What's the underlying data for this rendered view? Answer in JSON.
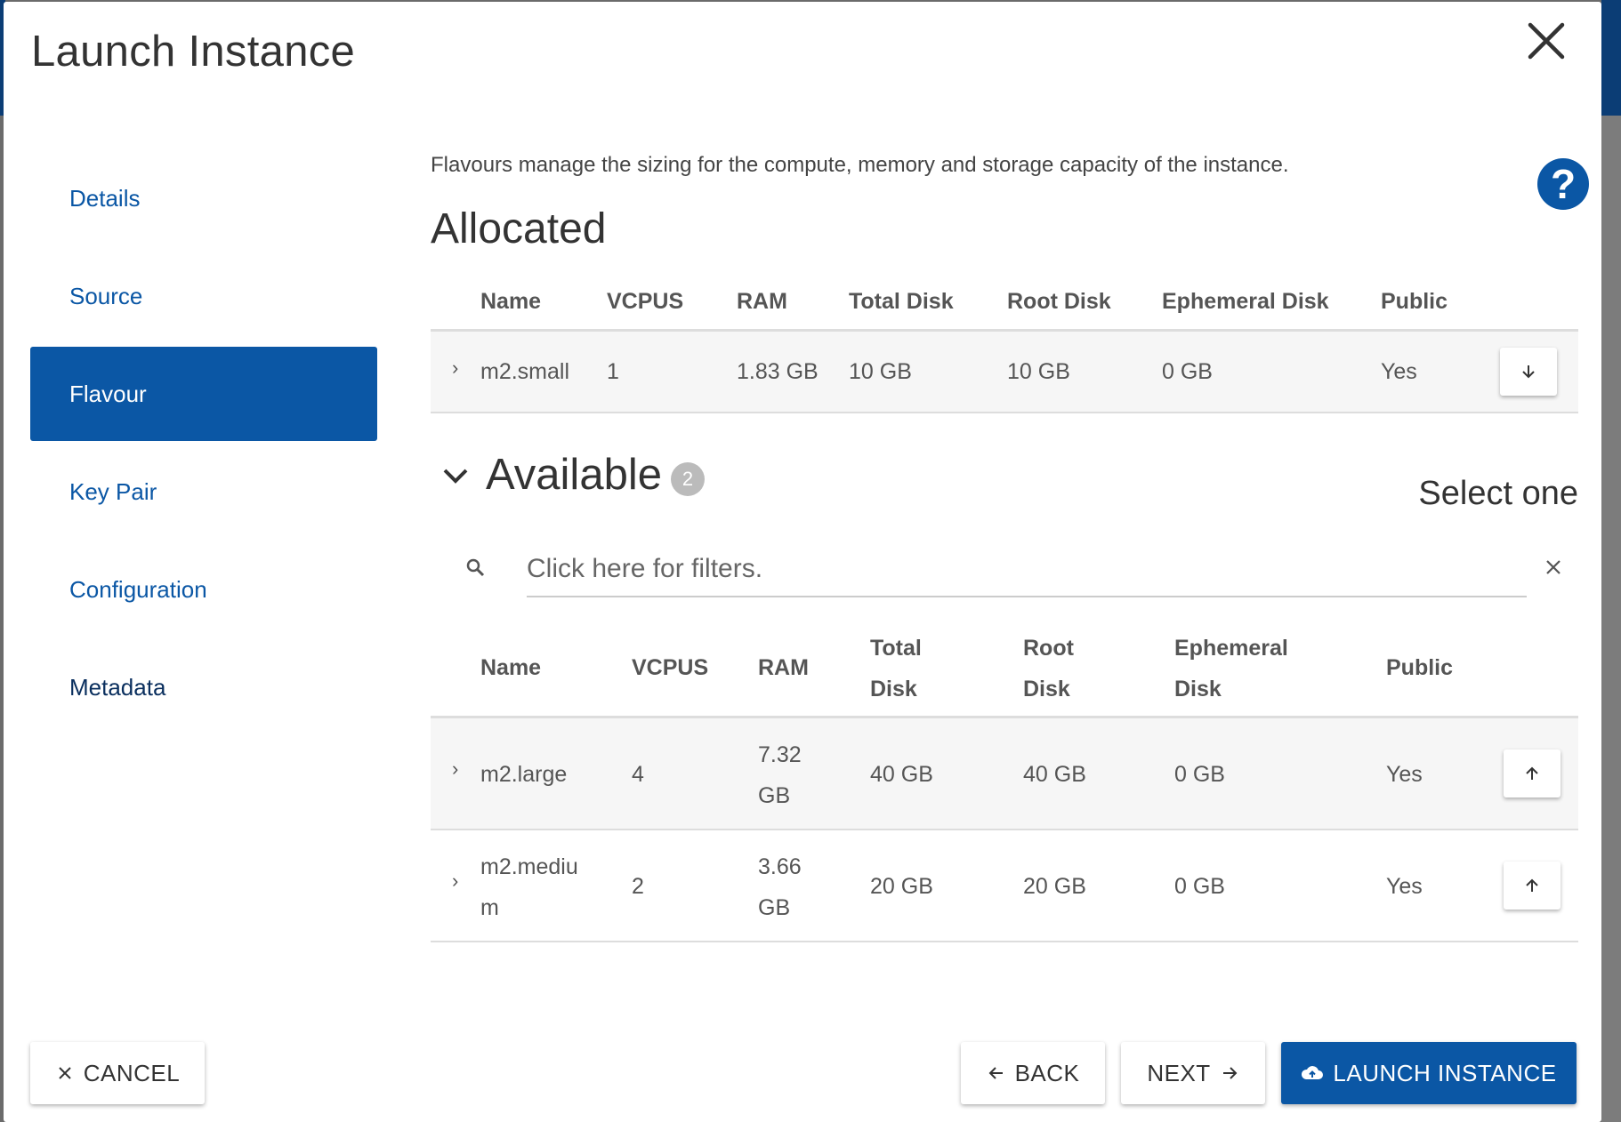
{
  "modal": {
    "title": "Launch Instance"
  },
  "nav": {
    "items": [
      {
        "label": "Details"
      },
      {
        "label": "Source"
      },
      {
        "label": "Flavour"
      },
      {
        "label": "Key Pair"
      },
      {
        "label": "Configuration"
      },
      {
        "label": "Metadata"
      }
    ],
    "active_index": 2
  },
  "flavour": {
    "help_text": "Flavours manage the sizing for the compute, memory and storage capacity of the instance.",
    "allocated": {
      "title": "Allocated",
      "headers": [
        "Name",
        "VCPUS",
        "RAM",
        "Total Disk",
        "Root Disk",
        "Ephemeral Disk",
        "Public"
      ],
      "rows": [
        {
          "name": "m2.small",
          "vcpus": "1",
          "ram": "1.83 GB",
          "total_disk": "10 GB",
          "root_disk": "10 GB",
          "ephemeral_disk": "0 GB",
          "public": "Yes"
        }
      ]
    },
    "available": {
      "title": "Available",
      "count": "2",
      "select_hint": "Select one",
      "filter_placeholder": "Click here for filters.",
      "headers": {
        "name": "Name",
        "vcpus": "VCPUS",
        "ram": "RAM",
        "total_disk": [
          "Total",
          "Disk"
        ],
        "root_disk": [
          "Root",
          "Disk"
        ],
        "ephemeral_disk": [
          "Ephemeral",
          "Disk"
        ],
        "public": "Public"
      },
      "rows": [
        {
          "name": [
            "m2.large"
          ],
          "vcpus": "4",
          "ram": [
            "7.32",
            "GB"
          ],
          "total_disk": "40 GB",
          "root_disk": "40 GB",
          "ephemeral_disk": "0 GB",
          "public": "Yes"
        },
        {
          "name": [
            "m2.mediu",
            "m"
          ],
          "vcpus": "2",
          "ram": [
            "3.66",
            "GB"
          ],
          "total_disk": "20 GB",
          "root_disk": "20 GB",
          "ephemeral_disk": "0 GB",
          "public": "Yes"
        }
      ]
    }
  },
  "footer": {
    "cancel_label": "CANCEL",
    "back_label": "BACK",
    "next_label": "NEXT",
    "launch_label": "LAUNCH INSTANCE"
  },
  "colors": {
    "primary": "#0b57a5",
    "header_bg": "#0b3d75"
  }
}
